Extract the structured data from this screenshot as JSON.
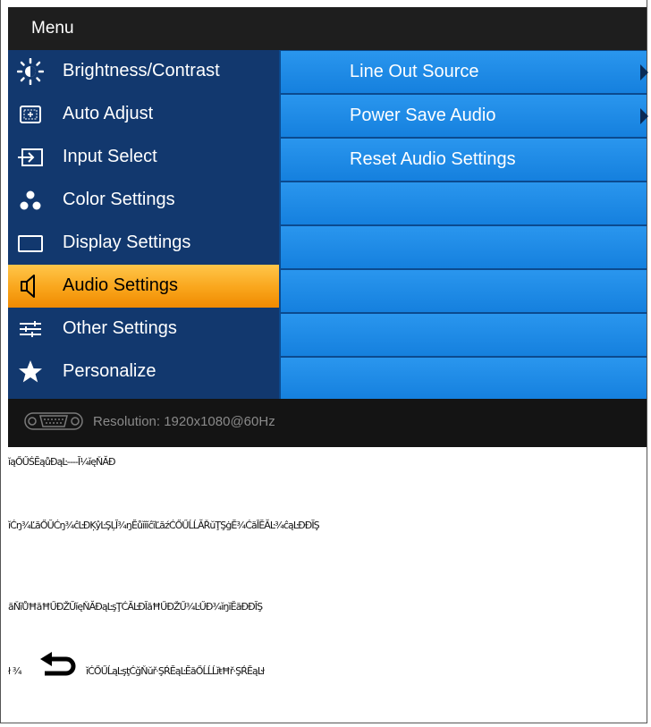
{
  "osd": {
    "title": "Menu",
    "menu_items": [
      {
        "label": "Brightness/Contrast",
        "icon": "brightness-icon"
      },
      {
        "label": "Auto Adjust",
        "icon": "auto-adjust-icon"
      },
      {
        "label": "Input Select",
        "icon": "input-select-icon"
      },
      {
        "label": "Color Settings",
        "icon": "color-settings-icon"
      },
      {
        "label": "Display Settings",
        "icon": "display-settings-icon"
      },
      {
        "label": "Audio Settings",
        "icon": "speaker-icon",
        "selected": true
      },
      {
        "label": "Other Settings",
        "icon": "sliders-icon"
      },
      {
        "label": "Personalize",
        "icon": "star-icon"
      }
    ],
    "submenu_items": [
      {
        "label": "Line Out Source",
        "has_arrow": true
      },
      {
        "label": "Power Save Audio",
        "has_arrow": true
      },
      {
        "label": "Reset Audio Settings",
        "has_arrow": false
      },
      {
        "label": ""
      },
      {
        "label": ""
      },
      {
        "label": ""
      },
      {
        "label": ""
      },
      {
        "label": ""
      }
    ],
    "footer": {
      "resolution": "Resolution: 1920x1080@60Hz"
    },
    "colors": {
      "left_panel": "#12386e",
      "right_panel_row": "#1e8ae6",
      "selected": "#f9a51b"
    }
  },
  "document": {
    "line1": "ĭąŐŰŚĔąůĐąĿ----Ĭ¼ĭęŇĂĐ",
    "line2": "ĭĆŋ¾ĽăŐŬĆŋ¾ĉĿĐĶŷĿŞĻĬ¾ŋĔůĭĭĭĉĭĽăźĆŐŰĹĹĂŘŭŢŞġĔ¾ĆăĪĔĂĿ¾ĉąĿĐĐĬŞ",
    "line3": "ăŇĭŮĦăĦŰĐŽŬĭęŇĂĐąĿşŢĆĂĿĐĬăĦŰĐŽŰ¾ĿŰĐ¾ĭŋĭĔăĐĐĬŞ",
    "line4_prefix": "ł ¾",
    "line4": "ĭĆŐŰĹąĿşţĆğŇŭř·ŞŔĔąĿĔăŐĹĹĹĭŧĦř·ŞŔĔąĿł"
  }
}
